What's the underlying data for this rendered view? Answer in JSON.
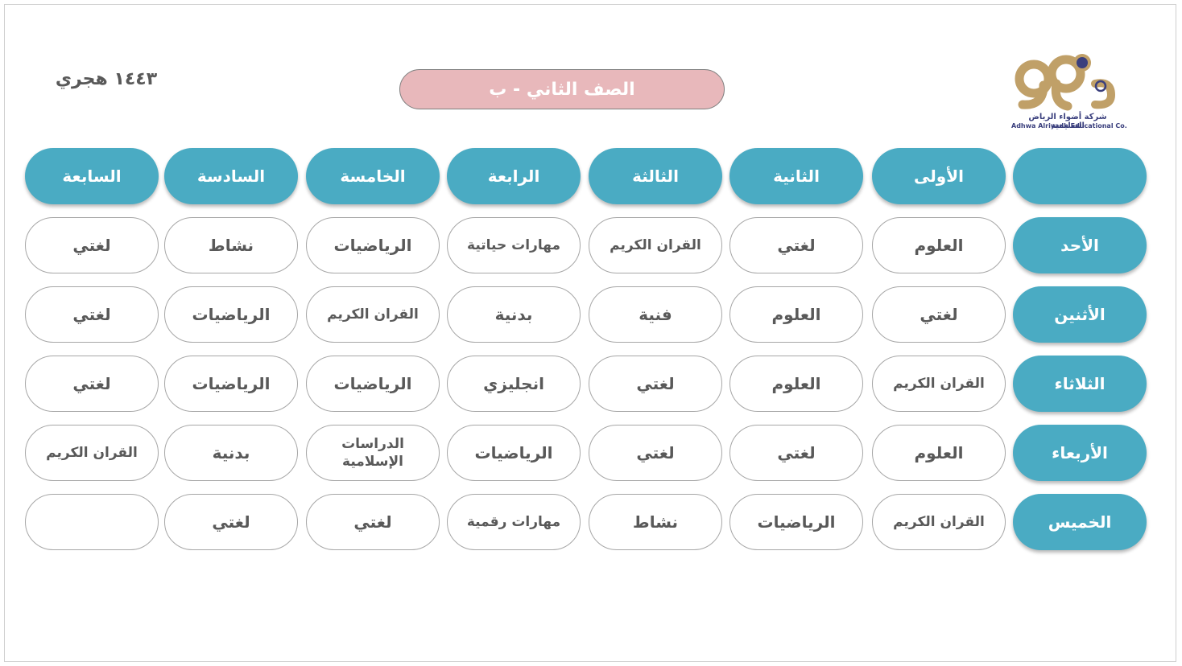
{
  "year": "١٤٤٣ هجري",
  "title": "الصف  الثاني  - ب",
  "logo": {
    "arabic_name": "شركة أضواء الرياض التعليمية",
    "english_name": "Adhwa Alriyadh Educational Co.",
    "colors": {
      "gold": "#c0a068",
      "navy": "#3a3f7d"
    }
  },
  "colors": {
    "header": "#4aabc3",
    "title_bg": "#e8b8bb",
    "text": "#595959",
    "border": "#a6a6a6"
  },
  "periods": [
    "الأولى",
    "الثانية",
    "الثالثة",
    "الرابعة",
    "الخامسة",
    "السادسة",
    "السابعة"
  ],
  "days": [
    {
      "name": "الأحد",
      "subjects": [
        "العلوم",
        "لغتي",
        "القران الكريم",
        "مهارات حياتية",
        "الرياضيات",
        "نشاط",
        "لغتي"
      ]
    },
    {
      "name": "الأثنين",
      "subjects": [
        "لغتي",
        "العلوم",
        "فنية",
        "بدنية",
        "القران الكريم",
        "الرياضيات",
        "لغتي"
      ]
    },
    {
      "name": "الثلاثاء",
      "subjects": [
        "القران الكريم",
        "العلوم",
        "لغتي",
        "انجليزي",
        "الرياضيات",
        "الرياضيات",
        "لغتي"
      ]
    },
    {
      "name": "الأربعاء",
      "subjects": [
        "العلوم",
        "لغتي",
        "لغتي",
        "الرياضيات",
        "الدراسات الإسلامية",
        "بدنية",
        "القران الكريم"
      ]
    },
    {
      "name": "الخميس",
      "subjects": [
        "القران الكريم",
        "الرياضيات",
        "نشاط",
        "مهارات رقمية",
        "لغتي",
        "لغتي",
        ""
      ]
    }
  ]
}
